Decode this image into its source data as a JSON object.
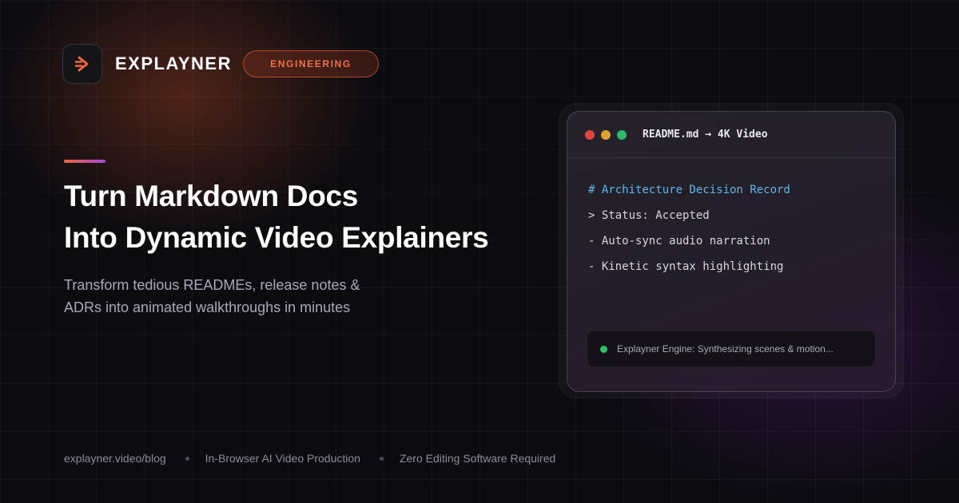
{
  "brand": {
    "name": "EXPLAYNER",
    "logo_icon": "arrow-play-icon",
    "category": "ENGINEERING"
  },
  "hero": {
    "headline_lines": [
      "Turn Markdown Docs",
      "Into Dynamic Video Explainers"
    ],
    "subtitle_lines": [
      "Transform tedious READMEs, release notes &",
      "ADRs into animated walkthroughs in minutes"
    ]
  },
  "editor": {
    "title": "README.md → 4K Video",
    "lines": [
      "# Architecture Decision Record",
      "> Status: Accepted",
      "- Auto-sync audio narration",
      "- Kinetic syntax highlighting"
    ],
    "status": "Explayner Engine: Synthesizing scenes & motion..."
  },
  "footer": {
    "items": [
      "explayner.video/blog",
      "In-Browser AI Video Production",
      "Zero Editing Software Required"
    ]
  },
  "colors": {
    "accent_orange": "#ee7147",
    "accent_purple": "#a24ad8",
    "code_heading": "#5fb6ea",
    "status_green": "#2fc46c"
  }
}
